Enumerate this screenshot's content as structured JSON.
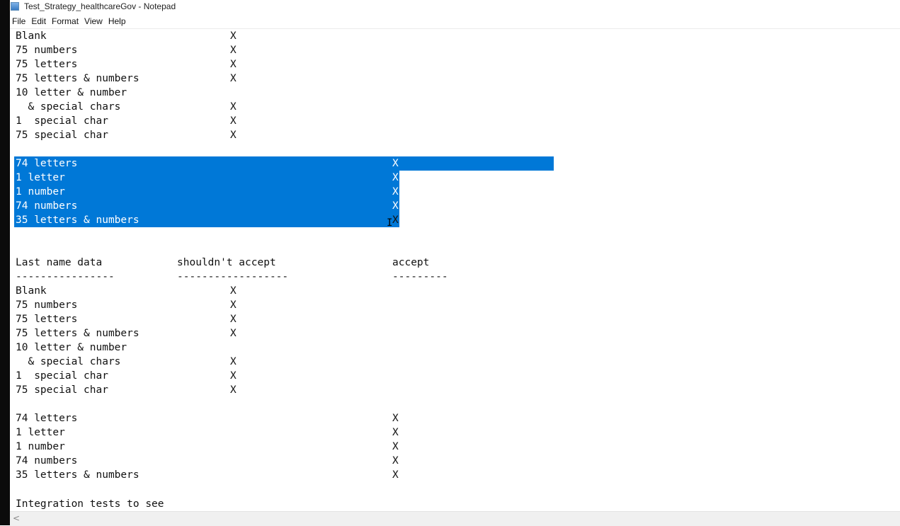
{
  "window": {
    "title": "Test_Strategy_healthcareGov - Notepad"
  },
  "menu": [
    "File",
    "Edit",
    "Format",
    "View",
    "Help"
  ],
  "first_name_rows": [
    {
      "label": "Blank",
      "mark": "X"
    },
    {
      "label": "75 numbers",
      "mark": "X"
    },
    {
      "label": "75 letters",
      "mark": "X"
    },
    {
      "label": "75 letters & numbers",
      "mark": "X"
    },
    {
      "label": "10 letter & number",
      "mark": ""
    },
    {
      "label": "  & special chars",
      "mark": "X"
    },
    {
      "label": "1  special char",
      "mark": "X"
    },
    {
      "label": "75 special char",
      "mark": "X"
    }
  ],
  "first_name_accept_rows": [
    {
      "label": "74 letters",
      "mark": "X"
    },
    {
      "label": "1 letter",
      "mark": "X"
    },
    {
      "label": "1 number",
      "mark": "X"
    },
    {
      "label": "74 numbers",
      "mark": "X"
    },
    {
      "label": "35 letters & numbers",
      "mark": "X"
    }
  ],
  "last_name_header": {
    "col1": "Last name data",
    "col2": "shouldn't accept",
    "col3": "accept",
    "dash1": "----------------",
    "dash2": "------------------",
    "dash3": "---------"
  },
  "last_name_rows": [
    {
      "label": "Blank",
      "mark": "X"
    },
    {
      "label": "75 numbers",
      "mark": "X"
    },
    {
      "label": "75 letters",
      "mark": "X"
    },
    {
      "label": "75 letters & numbers",
      "mark": "X"
    },
    {
      "label": "10 letter & number",
      "mark": ""
    },
    {
      "label": "  & special chars",
      "mark": "X"
    },
    {
      "label": "1  special char",
      "mark": "X"
    },
    {
      "label": "75 special char",
      "mark": "X"
    }
  ],
  "last_name_accept_rows": [
    {
      "label": "74 letters",
      "mark": "X"
    },
    {
      "label": "1 letter",
      "mark": "X"
    },
    {
      "label": "1 number",
      "mark": "X"
    },
    {
      "label": "74 numbers",
      "mark": "X"
    },
    {
      "label": "35 letters & numbers",
      "mark": "X"
    }
  ],
  "footer_line": "Integration tests to see",
  "scroll_left_arrow": "<",
  "colors": {
    "selection": "#0078d7",
    "taskbar": "#0b0b0b"
  }
}
